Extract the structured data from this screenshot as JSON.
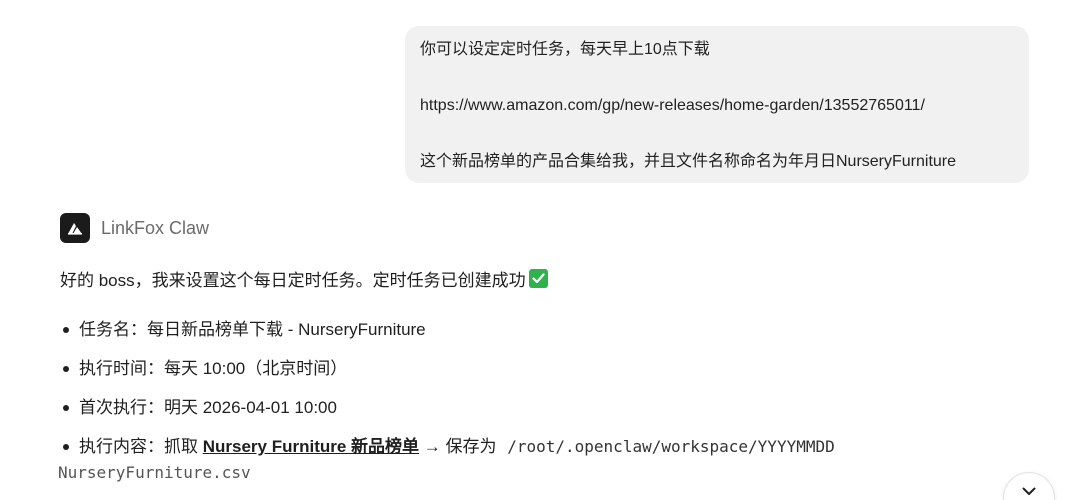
{
  "user_message": {
    "line1": "你可以设定定时任务，每天早上10点下载",
    "line2": "https://www.amazon.com/gp/new-releases/home-garden/13552765011/",
    "line3": "这个新品榜单的产品合集给我，并且文件名称命名为年月日NurseryFurniture"
  },
  "agent": {
    "name": "LinkFox Claw",
    "avatar_icon": "linkfox-logo-icon"
  },
  "reply": {
    "intro": "好的 boss，我来设置这个每日定时任务。定时任务已创建成功",
    "intro_emoji": "check-mark-button-icon",
    "items": [
      {
        "label": "任务名：",
        "value": "每日新品榜单下载 - NurseryFurniture"
      },
      {
        "label": "执行时间：",
        "value": "每天 10:00（北京时间）"
      },
      {
        "label": "首次执行：",
        "value": "明天 2026-04-01 10:00"
      },
      {
        "label": "执行内容：",
        "prefix": "抓取 ",
        "link": "Nursery Furniture 新品榜单",
        "arrow": " → 保存为 ",
        "path": "/root/.openclaw/workspace/YYYYMMDD",
        "path_cont": "NurseryFurniture.csv"
      }
    ]
  },
  "colors": {
    "bubble_bg": "#f1f1f1",
    "check_green": "#2fb24c"
  },
  "scroll_button_icon": "chevron-down-icon"
}
